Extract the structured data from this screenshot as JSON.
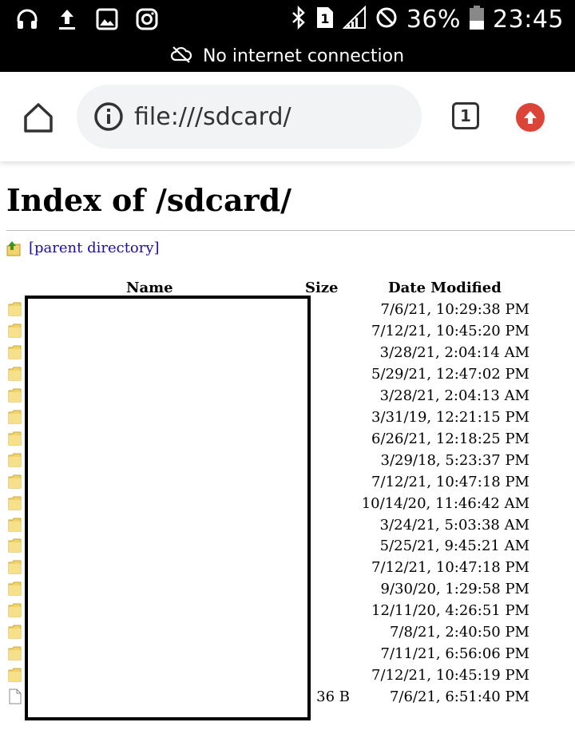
{
  "status_bar": {
    "left_icons": [
      "headphones-icon",
      "upload-icon",
      "gallery-icon",
      "instagram-icon"
    ],
    "battery_percent": "36%",
    "time": "23:45",
    "notice": "No internet connection"
  },
  "toolbar": {
    "url": "file:///sdcard/",
    "tab_count": "1"
  },
  "page": {
    "title": "Index of /sdcard/",
    "parent_link": "[parent directory]",
    "columns": {
      "name": "Name",
      "size": "Size",
      "date": "Date Modified"
    },
    "rows": [
      {
        "type": "folder",
        "size": "",
        "date": "7/6/21, 10:29:38 PM"
      },
      {
        "type": "folder",
        "size": "",
        "date": "7/12/21, 10:45:20 PM"
      },
      {
        "type": "folder",
        "size": "",
        "date": "3/28/21, 2:04:14 AM"
      },
      {
        "type": "folder",
        "size": "",
        "date": "5/29/21, 12:47:02 PM"
      },
      {
        "type": "folder",
        "size": "",
        "date": "3/28/21, 2:04:13 AM"
      },
      {
        "type": "folder",
        "size": "",
        "date": "3/31/19, 12:21:15 PM"
      },
      {
        "type": "folder",
        "size": "",
        "date": "6/26/21, 12:18:25 PM"
      },
      {
        "type": "folder",
        "size": "",
        "date": "3/29/18, 5:23:37 PM"
      },
      {
        "type": "folder",
        "size": "",
        "date": "7/12/21, 10:47:18 PM"
      },
      {
        "type": "folder",
        "size": "",
        "date": "10/14/20, 11:46:42 AM"
      },
      {
        "type": "folder",
        "size": "",
        "date": "3/24/21, 5:03:38 AM"
      },
      {
        "type": "folder",
        "size": "",
        "date": "5/25/21, 9:45:21 AM"
      },
      {
        "type": "folder",
        "size": "",
        "date": "7/12/21, 10:47:18 PM"
      },
      {
        "type": "folder",
        "size": "",
        "date": "9/30/20, 1:29:58 PM"
      },
      {
        "type": "folder",
        "size": "",
        "date": "12/11/20, 4:26:51 PM"
      },
      {
        "type": "folder",
        "size": "",
        "date": "7/8/21, 2:40:50 PM"
      },
      {
        "type": "folder",
        "size": "",
        "date": "7/11/21, 6:56:06 PM"
      },
      {
        "type": "folder",
        "size": "",
        "date": "7/12/21, 10:45:19 PM"
      },
      {
        "type": "file",
        "size": "36 B",
        "date": "7/6/21, 6:51:40 PM"
      }
    ]
  }
}
